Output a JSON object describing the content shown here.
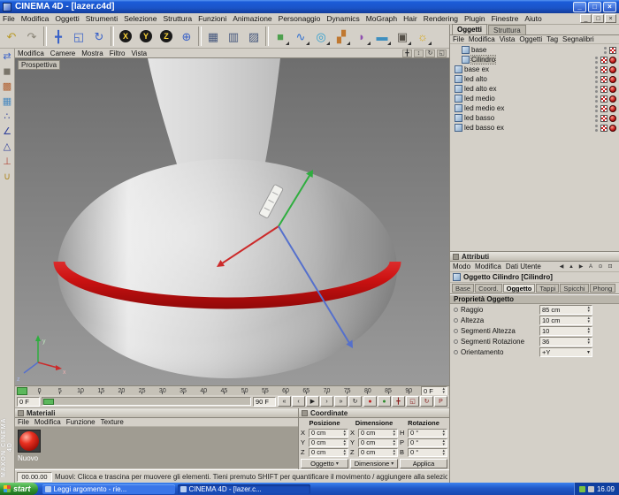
{
  "titlebar": {
    "title": "CINEMA 4D - [lazer.c4d]",
    "buttons": [
      {
        "name": "minimize-button",
        "glyph": "_"
      },
      {
        "name": "maximize-button",
        "glyph": "□"
      },
      {
        "name": "close-button",
        "glyph": "×"
      }
    ]
  },
  "menubar": {
    "items": [
      "File",
      "Modifica",
      "Oggetti",
      "Strumenti",
      "Selezione",
      "Struttura",
      "Funzioni",
      "Animazione",
      "Personaggio",
      "Dynamics",
      "MoGraph",
      "Hair",
      "Rendering",
      "Plugin",
      "Finestre",
      "Aiuto"
    ],
    "mdi_buttons": [
      {
        "name": "mdi-minimize-button",
        "glyph": "_"
      },
      {
        "name": "mdi-restore-button",
        "glyph": "□"
      },
      {
        "name": "mdi-close-button",
        "glyph": "×"
      }
    ]
  },
  "toolbar": {
    "icons": [
      {
        "name": "undo-icon",
        "glyph": "↶",
        "color": "#b89a2a"
      },
      {
        "name": "redo-icon",
        "glyph": "↷",
        "color": "#8a8578"
      },
      {
        "sep": true
      },
      {
        "name": "move-tool-icon",
        "glyph": "╋",
        "color": "#3a62c8"
      },
      {
        "name": "scale-tool-icon",
        "glyph": "◱",
        "color": "#3a62c8"
      },
      {
        "name": "rotate-tool-icon",
        "glyph": "↻",
        "color": "#3a62c8"
      },
      {
        "sep": true
      },
      {
        "name": "lock-x-icon",
        "glyph": "X",
        "color": "#ffd83a",
        "bg": "#1a1a1a"
      },
      {
        "name": "lock-y-icon",
        "glyph": "Y",
        "color": "#ffd83a",
        "bg": "#1a1a1a"
      },
      {
        "name": "lock-z-icon",
        "glyph": "Z",
        "color": "#ffd83a",
        "bg": "#1a1a1a"
      },
      {
        "name": "coordinate-system-icon",
        "glyph": "⊕",
        "color": "#3a62c8"
      },
      {
        "sep": true
      },
      {
        "name": "render-view-icon",
        "glyph": "▦",
        "color": "#46587e"
      },
      {
        "name": "render-picture-icon",
        "glyph": "▥",
        "color": "#46587e"
      },
      {
        "name": "render-settings-icon",
        "glyph": "▨",
        "color": "#46587e"
      },
      {
        "sep": true
      },
      {
        "name": "add-primitive-icon",
        "glyph": "■",
        "color": "#4ea04e",
        "dd": true
      },
      {
        "name": "add-spline-icon",
        "glyph": "∿",
        "color": "#2f6fd0",
        "dd": true
      },
      {
        "name": "add-nurbs-icon",
        "glyph": "◎",
        "color": "#2f9fd0",
        "dd": true
      },
      {
        "name": "add-array-icon",
        "glyph": "▞",
        "color": "#c07830",
        "dd": true
      },
      {
        "name": "add-deformer-icon",
        "glyph": "◗",
        "color": "#9050b0",
        "dd": true
      },
      {
        "name": "add-scene-icon",
        "glyph": "▬",
        "color": "#3f8fbf",
        "dd": true
      },
      {
        "name": "add-camera-icon",
        "glyph": "▣",
        "color": "#555048",
        "dd": true
      },
      {
        "name": "add-light-icon",
        "glyph": "☼",
        "color": "#d8a818",
        "dd": true
      }
    ]
  },
  "left_toolbar": {
    "icons": [
      {
        "name": "convert-object-icon",
        "glyph": "⇄",
        "color": "#3a62c8"
      },
      {
        "name": "model-mode-icon",
        "glyph": "◼",
        "color": "#7a756a"
      },
      {
        "name": "texture-mode-icon",
        "glyph": "▩",
        "color": "#b06030"
      },
      {
        "name": "workplane-icon",
        "glyph": "▦",
        "color": "#4a8ac0"
      },
      {
        "name": "points-mode-icon",
        "glyph": "∴",
        "color": "#30409a"
      },
      {
        "name": "edges-mode-icon",
        "glyph": "∠",
        "color": "#30409a"
      },
      {
        "name": "polygons-mode-icon",
        "glyph": "△",
        "color": "#30409a"
      },
      {
        "name": "axis-mode-icon",
        "glyph": "⊥",
        "color": "#b04a3a"
      },
      {
        "name": "snap-icon",
        "glyph": "∪",
        "color": "#b08a2a"
      }
    ]
  },
  "viewport": {
    "label": "Prospettiva",
    "menu": [
      "Modifica",
      "Camere",
      "Mostra",
      "Filtro",
      "Vista"
    ],
    "controls": [
      {
        "name": "pan-view-icon",
        "glyph": "╋"
      },
      {
        "name": "zoom-view-icon",
        "glyph": "↕"
      },
      {
        "name": "rotate-view-icon",
        "glyph": "↻"
      },
      {
        "name": "toggle-view-icon",
        "glyph": "◱"
      }
    ],
    "axis_labels": [
      "x",
      "y",
      "z"
    ]
  },
  "timeline": {
    "ticks": [
      "0",
      "5",
      "10",
      "15",
      "20",
      "25",
      "30",
      "35",
      "40",
      "45",
      "50",
      "55",
      "60",
      "65",
      "70",
      "75",
      "80",
      "85",
      "90"
    ],
    "current": "0 F",
    "range_start": "0 F",
    "range_end": "90 F",
    "transport": [
      {
        "name": "goto-start-button",
        "glyph": "«"
      },
      {
        "name": "prev-key-button",
        "glyph": "‹"
      },
      {
        "name": "play-button",
        "glyph": "▶"
      },
      {
        "name": "next-key-button",
        "glyph": "›"
      },
      {
        "name": "goto-end-button",
        "glyph": "»"
      },
      {
        "name": "loop-button",
        "glyph": "↻"
      }
    ],
    "record": [
      {
        "name": "record-keyframe-button",
        "glyph": "●",
        "color": "#c02020"
      },
      {
        "name": "autokey-button",
        "glyph": "●",
        "color": "#2a8a2a"
      },
      {
        "name": "record-position-button",
        "glyph": "╋",
        "color": "#8a2020"
      },
      {
        "name": "record-scale-button",
        "glyph": "◱",
        "color": "#8a2020"
      },
      {
        "name": "record-rotation-button",
        "glyph": "↻",
        "color": "#8a2020"
      },
      {
        "name": "record-parameter-button",
        "glyph": "P",
        "color": "#8a2020"
      }
    ]
  },
  "materials": {
    "title": "Materiali",
    "menu": [
      "File",
      "Modifica",
      "Funzione",
      "Texture"
    ],
    "items": [
      {
        "name": "Nuovo"
      }
    ]
  },
  "coordinates": {
    "title": "Coordinate",
    "headers": [
      "Posizione",
      "Dimensione",
      "Rotazione"
    ],
    "posizione": [
      {
        "label": "X",
        "value": "0 cm"
      },
      {
        "label": "Y",
        "value": "0 cm"
      },
      {
        "label": "Z",
        "value": "0 cm"
      }
    ],
    "dimensione": [
      {
        "label": "X",
        "value": "0 cm"
      },
      {
        "label": "Y",
        "value": "0 cm"
      },
      {
        "label": "Z",
        "value": "0 cm"
      }
    ],
    "rotazione": [
      {
        "label": "H",
        "value": "0 °"
      },
      {
        "label": "P",
        "value": "0 °"
      },
      {
        "label": "B",
        "value": "0 °"
      }
    ],
    "footer": [
      {
        "name": "object-space-dropdown",
        "label": "Oggetto",
        "dd": true
      },
      {
        "name": "size-mode-dropdown",
        "label": "Dimensione",
        "dd": true
      },
      {
        "name": "apply-button",
        "label": "Applica"
      }
    ]
  },
  "object_manager": {
    "tabs": [
      {
        "label": "Oggetti",
        "active": true
      },
      {
        "label": "Struttura"
      }
    ],
    "menu": [
      "File",
      "Modifica",
      "Vista",
      "Oggetti",
      "Tag",
      "Segnalibri"
    ],
    "objects": [
      {
        "name": "base",
        "indent": 1,
        "tags": [
          "checker"
        ]
      },
      {
        "name": "Cilindro",
        "indent": 1,
        "selected": true,
        "tags": [
          "checker",
          "ball"
        ]
      },
      {
        "name": "base ex",
        "indent": 0,
        "tags": [
          "checker",
          "ball"
        ]
      },
      {
        "name": "led alto",
        "indent": 0,
        "tags": [
          "checker",
          "ball"
        ]
      },
      {
        "name": "led alto ex",
        "indent": 0,
        "tags": [
          "checker",
          "ball"
        ]
      },
      {
        "name": "led medio",
        "indent": 0,
        "tags": [
          "checker",
          "ball"
        ]
      },
      {
        "name": "led medio ex",
        "indent": 0,
        "tags": [
          "checker",
          "ball"
        ]
      },
      {
        "name": "led basso",
        "indent": 0,
        "tags": [
          "checker",
          "ball"
        ]
      },
      {
        "name": "led basso ex",
        "indent": 0,
        "tags": [
          "checker",
          "ball"
        ]
      }
    ]
  },
  "attributes": {
    "title": "Attributi",
    "menu": [
      "Modo",
      "Modifica",
      "Dati Utente"
    ],
    "nav": [
      {
        "name": "nav-back-icon",
        "glyph": "◀"
      },
      {
        "name": "nav-up-icon",
        "glyph": "▲"
      },
      {
        "name": "nav-forward-icon",
        "glyph": "▶"
      },
      {
        "name": "filter-icon",
        "glyph": "A"
      },
      {
        "name": "search-icon",
        "glyph": "⊙"
      },
      {
        "name": "lock-icon",
        "glyph": "⊡"
      }
    ],
    "object_header": "Oggetto Cilindro [Cilindro]",
    "tabs": [
      {
        "label": "Base"
      },
      {
        "label": "Coord."
      },
      {
        "label": "Oggetto",
        "active": true
      },
      {
        "label": "Tappi"
      },
      {
        "label": "Spicchi"
      },
      {
        "label": "Phong"
      }
    ],
    "section": "Proprietà Oggetto",
    "fields": [
      {
        "label": "Raggio",
        "value": "85 cm",
        "stepper": true
      },
      {
        "label": "Altezza",
        "value": "10 cm",
        "stepper": true
      },
      {
        "label": "Segmenti Altezza",
        "value": "10",
        "stepper": true
      },
      {
        "label": "Segmenti Rotazione",
        "value": "36",
        "stepper": true
      },
      {
        "label": "Orientamento",
        "value": "+Y",
        "dropdown": true
      }
    ]
  },
  "statusbar": {
    "time": "00.00.00",
    "text": "Muovi: Clicca e trascina per muovere gli elementi. Tieni premuto SHIFT per quantificare il movimento / aggiungere alla selezione in modo punto, CTRL per rimuovere."
  },
  "taskbar": {
    "start": "start",
    "tasks": [
      {
        "label": "Leggi argomento - rie..."
      },
      {
        "label": "CINEMA 4D - [lazer.c...",
        "active": true
      }
    ],
    "clock": "16.09"
  },
  "branding": {
    "vertical": "MAXON CINEMA 4D"
  }
}
